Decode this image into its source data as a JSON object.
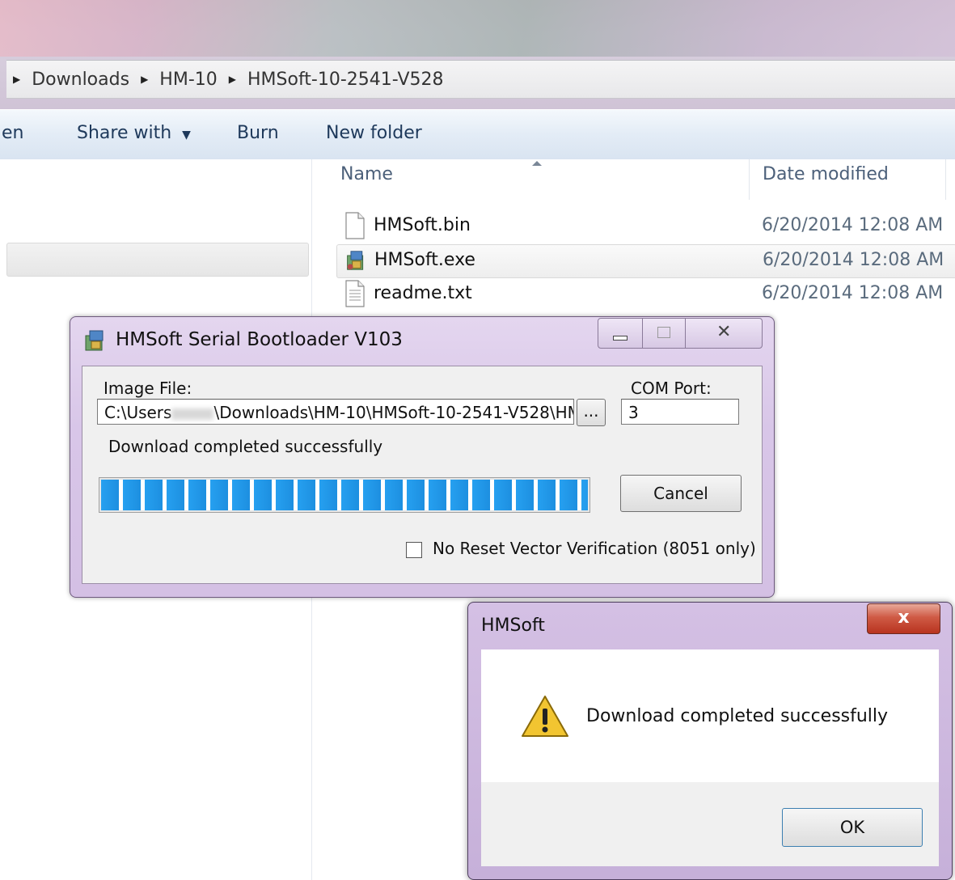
{
  "explorer": {
    "breadcrumbs": [
      "Downloads",
      "HM-10",
      "HMSoft-10-2541-V528"
    ],
    "commands": {
      "open_partial": "en",
      "share_with": "Share with",
      "burn": "Burn",
      "new_folder": "New folder"
    },
    "columns": {
      "name": "Name",
      "date_modified": "Date modified"
    },
    "files": [
      {
        "name": "HMSoft.bin",
        "date": "6/20/2014 12:08 AM",
        "icon": "file-icon"
      },
      {
        "name": "HMSoft.exe",
        "date": "6/20/2014 12:08 AM",
        "icon": "installer-icon"
      },
      {
        "name": "readme.txt",
        "date": "6/20/2014 12:08 AM",
        "icon": "text-file-icon"
      }
    ]
  },
  "bootloader": {
    "title": "HMSoft Serial Bootloader  V103",
    "image_file_label": "Image File:",
    "image_file_value_prefix": "C:\\Users",
    "image_file_value_suffix": "\\Downloads\\HM-10\\HMSoft-10-2541-V528\\HM:",
    "browse_label": "...",
    "com_port_label": "COM Port:",
    "com_port_value": "3",
    "status": "Download completed successfully",
    "progress": 1.0,
    "cancel_label": "Cancel",
    "no_reset_label": "No Reset Vector Verification (8051 only)",
    "no_reset_checked": false
  },
  "message_box": {
    "title": "HMSoft",
    "close_label": "x",
    "text": "Download completed successfully",
    "icon": "warning-icon",
    "ok_label": "OK"
  }
}
